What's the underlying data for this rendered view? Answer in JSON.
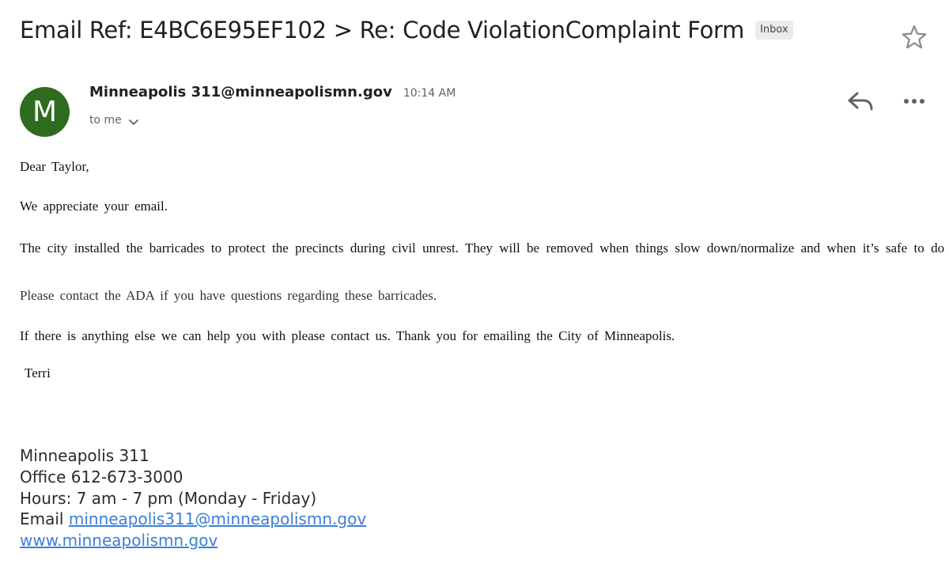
{
  "header": {
    "subject": "Email Ref: E4BC6E95EF102 > Re: Code ViolationComplaint Form",
    "label_badge": "Inbox",
    "star_icon": "star-outline-icon"
  },
  "message": {
    "avatar_letter": "M",
    "avatar_color": "#2f6b1e",
    "sender": "Minneapolis 311@minneapolismn.gov",
    "time": "10:14 AM",
    "recipient": "to me",
    "actions": {
      "reply_icon": "reply-icon",
      "more_icon": "more-horizontal-icon"
    },
    "body": {
      "greeting": "Dear Taylor,",
      "p1": "We appreciate your email.",
      "p2": "The city installed the barricades to protect the precincts during civil unrest. They will be removed when things slow down/normalize and when it’s safe to do so.",
      "p3": "Please contact the ADA if you have questions regarding these barricades.",
      "p4": "If there is anything else we can help you with please contact us.  Thank you for emailing the City of Minneapolis.",
      "signoff": "Terri"
    },
    "signature": {
      "org": "Minneapolis 311",
      "office": "Office 612-673-3000",
      "hours": "Hours: 7 am - 7 pm (Monday - Friday)",
      "email_label": "Email",
      "email_link": "minneapolis311@minneapolismn.gov",
      "website_link": "www.minneapolismn.gov"
    }
  },
  "colors": {
    "link": "#3d7fd6",
    "badge_bg": "#ebebeb"
  }
}
